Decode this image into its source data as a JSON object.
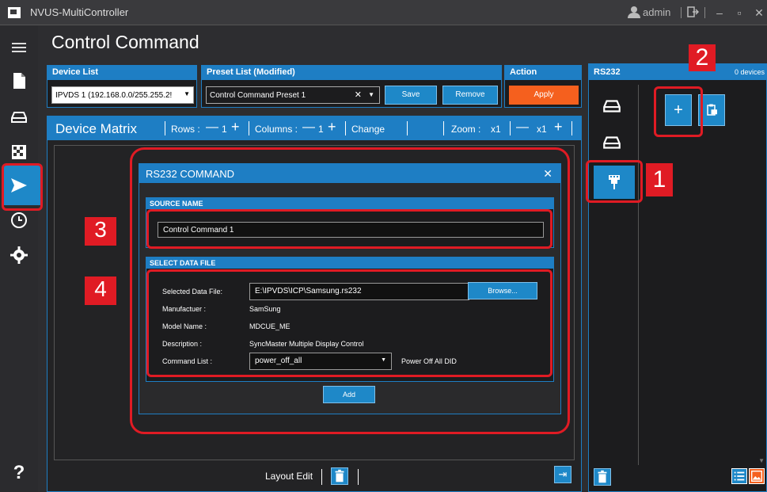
{
  "window": {
    "title": "NVUS-MultiController",
    "user": "admin"
  },
  "page": {
    "title": "Control Command"
  },
  "device_list": {
    "header": "Device List",
    "value": "IPVDS 1 (192.168.0.0/255.255.2!"
  },
  "preset_list": {
    "header": "Preset List (Modified)",
    "value": "Control Command Preset 1",
    "save_label": "Save",
    "remove_label": "Remove"
  },
  "action": {
    "header": "Action",
    "apply_label": "Apply"
  },
  "matrix": {
    "title": "Device Matrix",
    "rows_label": "Rows :",
    "rows_value": "1",
    "columns_label": "Columns :",
    "columns_value": "1",
    "change_label": "Change",
    "zoom_label": "Zoom :",
    "zoom_value": "x1",
    "zoom_value2": "x1",
    "layout_edit_label": "Layout Edit"
  },
  "dialog": {
    "title": "RS232 COMMAND",
    "source_section": "SOURCE NAME",
    "source_name": "Control Command 1",
    "data_section": "SELECT DATA FILE",
    "selected_file_label": "Selected Data File:",
    "selected_file_value": "E:\\IPVDS\\ICP\\Samsung.rs232",
    "browse_label": "Browse...",
    "manufacturer_label": "Manufactuer :",
    "manufacturer_value": "SamSung",
    "model_label": "Model Name :",
    "model_value": "MDCUE_ME",
    "description_label": "Description :",
    "description_value": "SyncMaster Multiple Display Control",
    "command_list_label": "Command List :",
    "command_list_value": "power_off_all",
    "command_desc": "Power Off All DID",
    "add_label": "Add"
  },
  "right_panel": {
    "title": "RS232",
    "count": "0 devices"
  },
  "annotations": {
    "n1": "1",
    "n2": "2",
    "n3": "3",
    "n4": "4"
  },
  "colors": {
    "accent": "#1e7ec4",
    "highlight": "#e01b24",
    "apply": "#f5601e"
  }
}
